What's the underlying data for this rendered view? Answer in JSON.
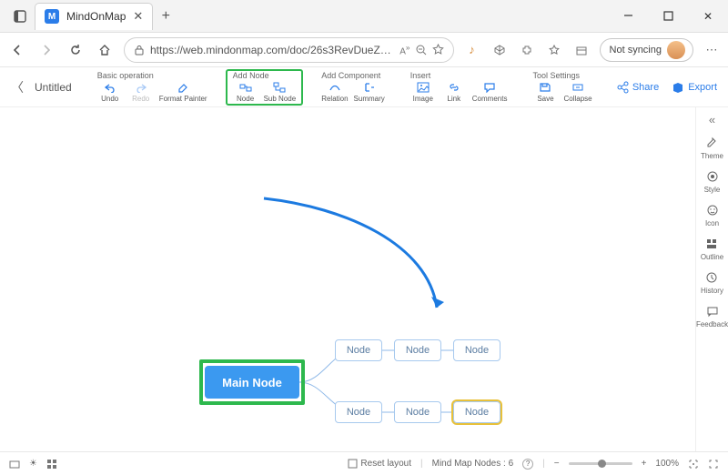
{
  "browser": {
    "tab_title": "MindOnMap",
    "url": "https://web.mindonmap.com/doc/26s3RevDueZH...",
    "sync_label": "Not syncing"
  },
  "app": {
    "doc_title": "Untitled",
    "share_label": "Share",
    "export_label": "Export",
    "groups": {
      "basic": {
        "head": "Basic operation",
        "undo": "Undo",
        "redo": "Redo",
        "fp": "Format Painter"
      },
      "add_node": {
        "head": "Add Node",
        "node": "Node",
        "sub": "Sub Node"
      },
      "add_comp": {
        "head": "Add Component",
        "rel": "Relation",
        "sum": "Summary"
      },
      "insert": {
        "head": "Insert",
        "img": "Image",
        "link": "Link",
        "cmt": "Comments"
      },
      "tool": {
        "head": "Tool Settings",
        "save": "Save",
        "col": "Collapse"
      }
    }
  },
  "canvas": {
    "main": "Main Node",
    "leaf": "Node",
    "leaf_sel": "Node"
  },
  "right_panel": {
    "theme": "Theme",
    "style": "Style",
    "icon": "Icon",
    "outline": "Outline",
    "history": "History",
    "feedback": "Feedback"
  },
  "status": {
    "reset": "Reset layout",
    "nodes_label": "Mind Map Nodes :",
    "nodes_count": "6",
    "zoom": "100%"
  }
}
